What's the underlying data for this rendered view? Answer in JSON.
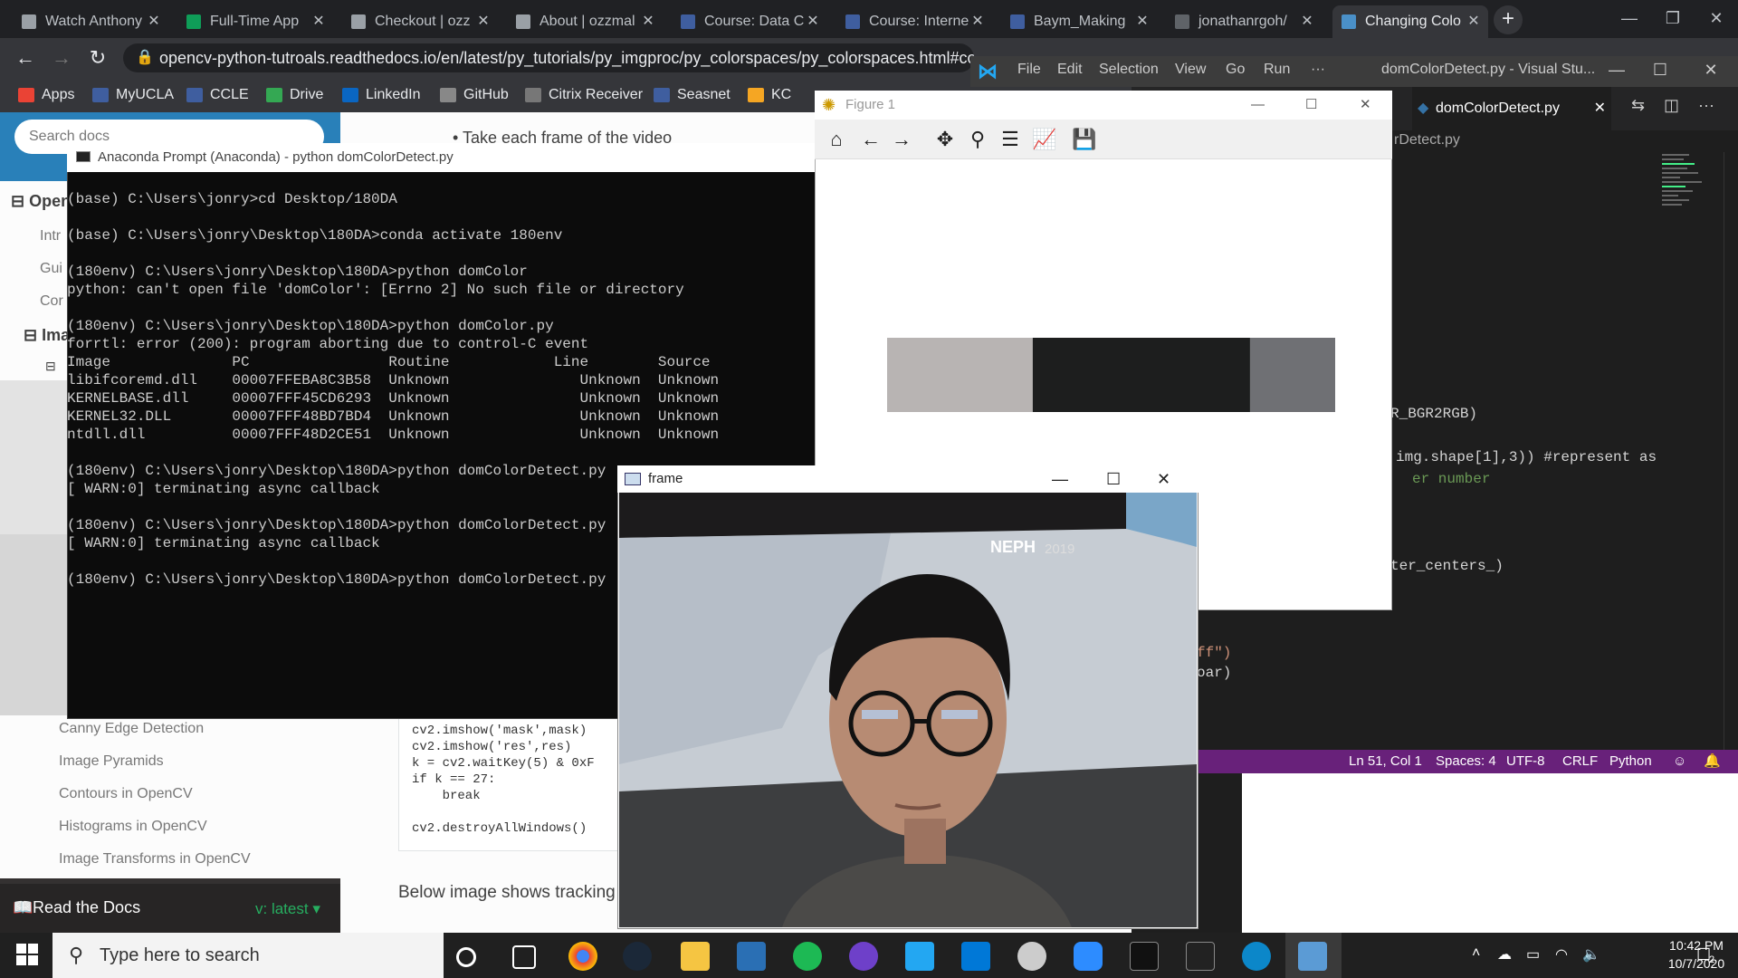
{
  "chrome": {
    "tabs": [
      {
        "title": "Watch Anthony",
        "color": "#9aa0a6"
      },
      {
        "title": "Full-Time App",
        "color": "#0f9d58"
      },
      {
        "title": "Checkout | ozz",
        "color": "#9aa0a6"
      },
      {
        "title": "About | ozzmal",
        "color": "#9aa0a6"
      },
      {
        "title": "Course: Data C",
        "color": "#3f5e9f"
      },
      {
        "title": "Course: Interne",
        "color": "#3f5e9f"
      },
      {
        "title": "Baym_Making",
        "color": "#3f5e9f"
      },
      {
        "title": "jonathanrgoh/",
        "color": "#5f6368"
      },
      {
        "title": "Changing Colo",
        "color": "#4a90c8"
      }
    ],
    "url": "opencv-python-tutroals.readthedocs.io/en/latest/py_tutorials/py_imgproc/py_colorspaces/py_colorspaces.html#con",
    "bookmarks": [
      "Apps",
      "MyUCLA",
      "CCLE",
      "Drive",
      "LinkedIn",
      "GitHub",
      "Citrix Receiver",
      "Seasnet",
      "KC"
    ]
  },
  "rtd": {
    "search_placeholder": "Search docs",
    "page_snippet": "Take each frame of the video",
    "nav_open": "Open",
    "nav_intro": "Intr",
    "nav_gui": "Gui",
    "nav_core": "Cor",
    "nav_image": "Ima",
    "nav_items": [
      "Canny Edge Detection",
      "Image Pyramids",
      "Contours in OpenCV",
      "Histograms in OpenCV",
      "Image Transforms in OpenCV"
    ],
    "code_lines": [
      "cv2.imshow('mask',mask)",
      "cv2.imshow('res',res)",
      "k = cv2.waitKey(5) & 0xF",
      "if k == 27:",
      "    break",
      "",
      "cv2.destroyAllWindows()"
    ],
    "below_text": "Below image shows tracking",
    "footer_label": "Read the Docs",
    "footer_version": "v: latest"
  },
  "vscode": {
    "menu": [
      "File",
      "Edit",
      "Selection",
      "View",
      "Go",
      "Run",
      "···"
    ],
    "title": "domColorDetect.py - Visual Stu...",
    "tab": "domColorDetect.py",
    "breadcrumb": "rDetect.py",
    "code_fragments": [
      "R_BGR2RGB)",
      "img.shape[1],3)) #represent as",
      "er number",
      "ter_centers_)",
      "ff\")",
      "oar)"
    ],
    "status": [
      "Ln 51, Col 1",
      "Spaces: 4",
      "UTF-8",
      "CRLF",
      "Python"
    ]
  },
  "anaconda": {
    "title": "Anaconda Prompt (Anaconda) - python  domColorDetect.py",
    "lines": [
      "(base) C:\\Users\\jonry>cd Desktop/180DA",
      "",
      "(base) C:\\Users\\jonry\\Desktop\\180DA>conda activate 180env",
      "",
      "(180env) C:\\Users\\jonry\\Desktop\\180DA>python domColor",
      "python: can't open file 'domColor': [Errno 2] No such file or directory",
      "",
      "(180env) C:\\Users\\jonry\\Desktop\\180DA>python domColor.py",
      "forrtl: error (200): program aborting due to control-C event",
      "Image              PC                Routine            Line        Source",
      "libifcoremd.dll    00007FFEBA8C3B58  Unknown               Unknown  Unknown",
      "KERNELBASE.dll     00007FFF45CD6293  Unknown               Unknown  Unknown",
      "KERNEL32.DLL       00007FFF48BD7BD4  Unknown               Unknown  Unknown",
      "ntdll.dll          00007FFF48D2CE51  Unknown               Unknown  Unknown",
      "",
      "(180env) C:\\Users\\jonry\\Desktop\\180DA>python domColorDetect.py",
      "[ WARN:0] terminating async callback",
      "",
      "(180env) C:\\Users\\jonry\\Desktop\\180DA>python domColorDetect.py",
      "[ WARN:0] terminating async callback",
      "",
      "(180env) C:\\Users\\jonry\\Desktop\\180DA>python domColorDetect.py"
    ]
  },
  "figure": {
    "title": "Figure 1",
    "color_bar": [
      {
        "color": "#b8b4b3",
        "fraction": 0.325
      },
      {
        "color": "#1d1e1e",
        "fraction": 0.485
      },
      {
        "color": "#6f7074",
        "fraction": 0.19
      }
    ]
  },
  "frame": {
    "title": "frame",
    "label": "NEPH",
    "year": "2019"
  },
  "taskbar": {
    "search_placeholder": "Type here to search",
    "time": "10:42 PM",
    "date": "10/7/2020",
    "notifications": "2"
  }
}
